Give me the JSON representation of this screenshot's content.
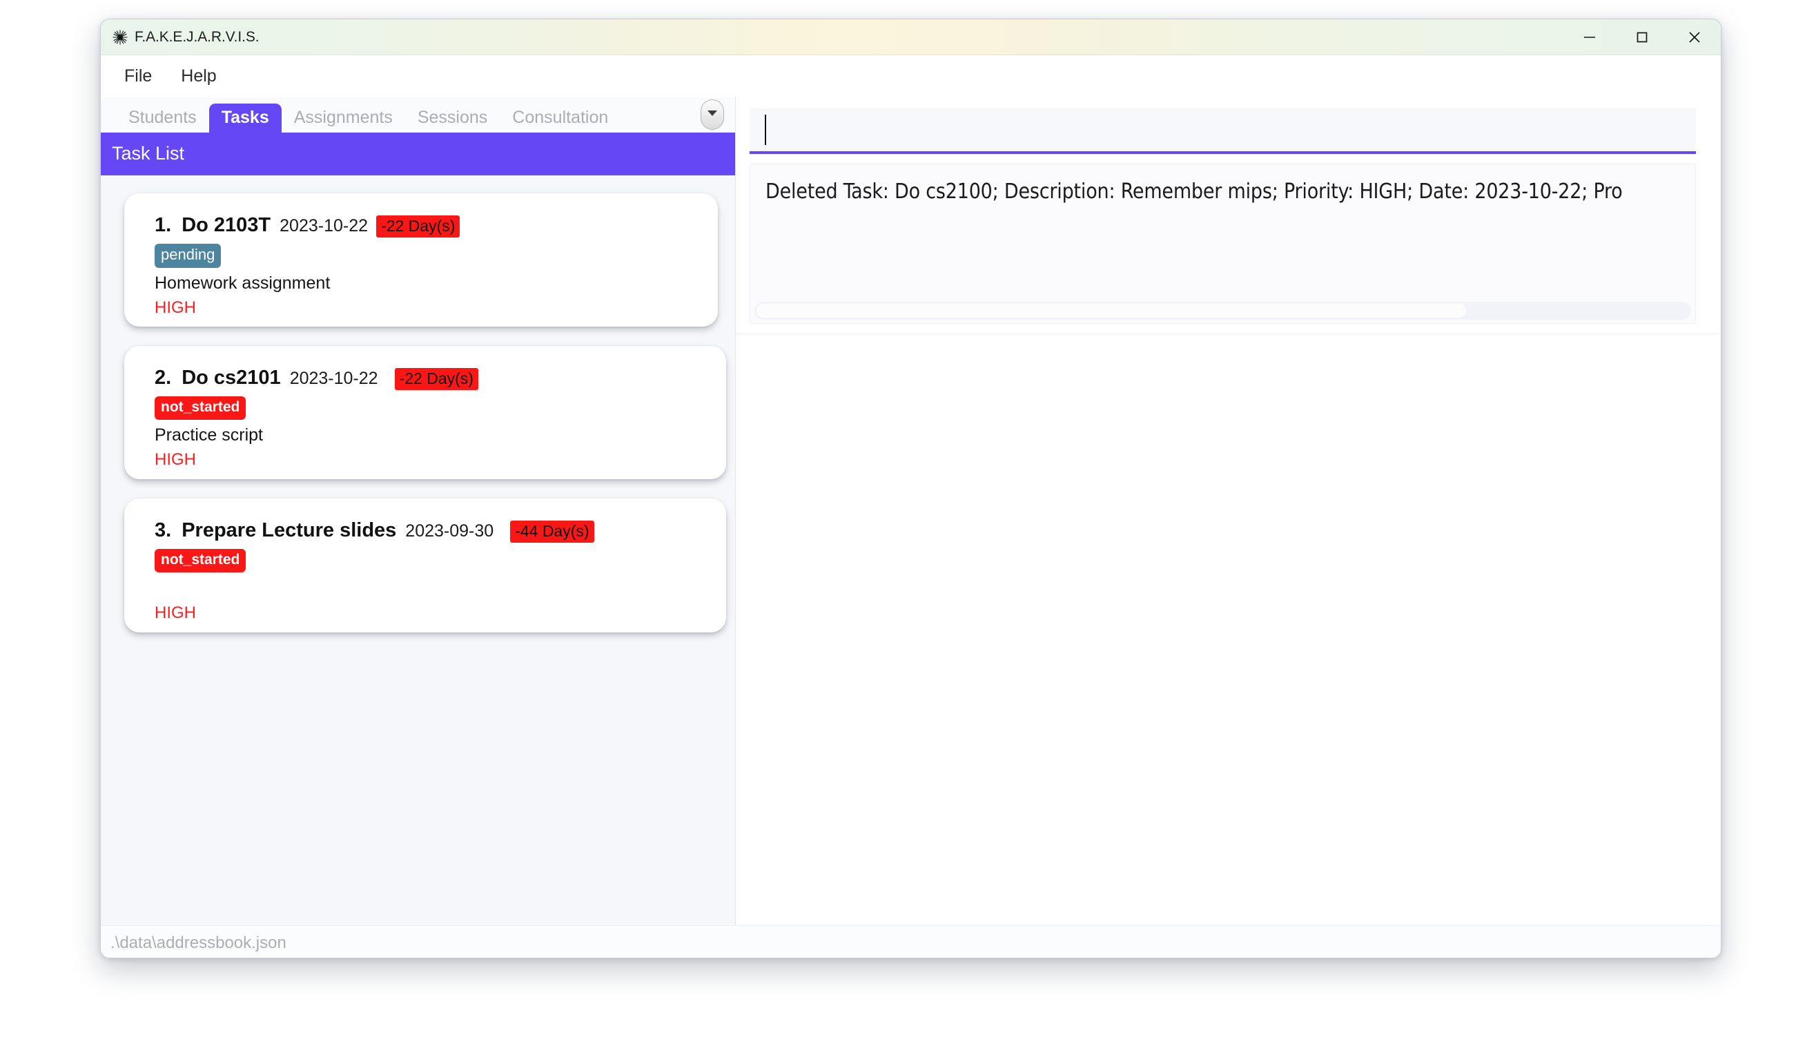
{
  "window": {
    "title": "F.A.K.E.J.A.R.V.I.S.",
    "icon": "snowflake-icon",
    "controls": {
      "minimize": "minimize-icon",
      "maximize": "maximize-icon",
      "close": "close-icon"
    },
    "accent_color": "#6647f5",
    "titlebar_colors": [
      "#e9f5ec",
      "#faf5dc",
      "#e7f3ea"
    ]
  },
  "menubar": {
    "items": [
      {
        "label": "File"
      },
      {
        "label": "Help"
      }
    ]
  },
  "tabs": {
    "items": [
      {
        "label": "Students",
        "active": false
      },
      {
        "label": "Tasks",
        "active": true
      },
      {
        "label": "Assignments",
        "active": false
      },
      {
        "label": "Sessions",
        "active": false
      },
      {
        "label": "Consultation",
        "active": false
      }
    ],
    "overflow_button": "chevron-down-icon"
  },
  "list_panel": {
    "header": "Task List",
    "tasks": [
      {
        "index": "1.",
        "name": "Do 2103T",
        "date": "2023-10-22",
        "days": "-22 Day(s)",
        "days_color": "#fc1717",
        "status": "pending",
        "status_color": "#4d84a0",
        "description": "Homework assignment",
        "priority": "HIGH",
        "priority_color": "#fb2020"
      },
      {
        "index": "2.",
        "name": "Do cs2101",
        "date": "2023-10-22",
        "days": "-22 Day(s)",
        "days_color": "#fc1717",
        "status": "not_started",
        "status_color": "#fc1717",
        "description": "Practice script",
        "priority": "HIGH",
        "priority_color": "#fb2020"
      },
      {
        "index": "3.",
        "name": "Prepare Lecture slides",
        "date": "2023-09-30",
        "days": "-44 Day(s)",
        "days_color": "#fc1717",
        "status": "not_started",
        "status_color": "#fc1717",
        "description": "",
        "priority": "HIGH",
        "priority_color": "#fb2020"
      }
    ]
  },
  "command": {
    "value": "",
    "placeholder": ""
  },
  "result": {
    "text": "Deleted Task: Do cs2100; Description: Remember mips; Priority: HIGH; Date: 2023-10-22; Pro"
  },
  "statusbar": {
    "path": ".\\data\\addressbook.json"
  }
}
